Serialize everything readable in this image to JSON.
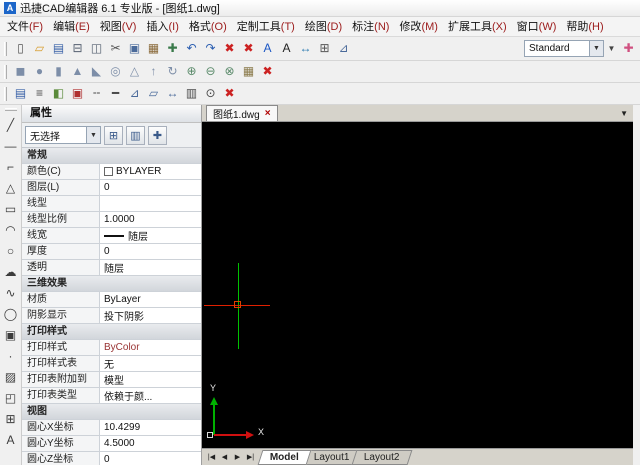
{
  "colors": {
    "canvas_bg": "#000000",
    "crosshair_x": "#e02000",
    "crosshair_y": "#00c000",
    "close_red": "#cc2222",
    "logo_blue": "#1d66c9",
    "bycolor_value": "#993333",
    "end_icon_pink": "#d05080"
  },
  "window": {
    "logo": "A",
    "title": "迅捷CAD编辑器 6.1 专业版 - [图纸1.dwg]"
  },
  "menu": {
    "items": [
      {
        "label": "文件",
        "key": "F"
      },
      {
        "label": "编辑",
        "key": "E"
      },
      {
        "label": "视图",
        "key": "V"
      },
      {
        "label": "插入",
        "key": "I"
      },
      {
        "label": "格式",
        "key": "O"
      },
      {
        "label": "定制工具",
        "key": "T"
      },
      {
        "label": "绘图",
        "key": "D"
      },
      {
        "label": "标注",
        "key": "N"
      },
      {
        "label": "修改",
        "key": "M"
      },
      {
        "label": "扩展工具",
        "key": "X"
      },
      {
        "label": "窗口",
        "key": "W"
      },
      {
        "label": "帮助",
        "key": "H"
      }
    ]
  },
  "toolbar1": {
    "icons": [
      {
        "name": "new-file-icon",
        "glyph": "▯",
        "color": "#555555"
      },
      {
        "name": "open-folder-icon",
        "glyph": "▱",
        "color": "#d79b2a"
      },
      {
        "name": "save-icon",
        "glyph": "▤",
        "color": "#3a62a8"
      },
      {
        "name": "print-icon",
        "glyph": "⊟",
        "color": "#556070"
      },
      {
        "name": "print-preview-icon",
        "glyph": "◫",
        "color": "#556070"
      },
      {
        "name": "cut-icon",
        "glyph": "✂",
        "color": "#555555"
      },
      {
        "name": "copy-icon",
        "glyph": "▣",
        "color": "#4a6a9a"
      },
      {
        "name": "paste-icon",
        "glyph": "▦",
        "color": "#8a6a3a"
      },
      {
        "name": "match-properties-icon",
        "glyph": "✚",
        "color": "#3a7a4a"
      },
      {
        "name": "undo-icon",
        "glyph": "↶",
        "color": "#2a5db0"
      },
      {
        "name": "redo-icon",
        "glyph": "↷",
        "color": "#2a5db0"
      },
      {
        "name": "erase-icon",
        "glyph": "✖",
        "color": "#cc2222"
      },
      {
        "name": "delete-icon",
        "glyph": "✖",
        "color": "#cc2222"
      },
      {
        "name": "text-style-icon",
        "glyph": "A",
        "color": "#1a56c4"
      },
      {
        "name": "text-icon",
        "glyph": "A",
        "color": "#222222"
      },
      {
        "name": "dimension-icon",
        "glyph": "↔",
        "color": "#2a7ab0"
      },
      {
        "name": "insert-table-icon",
        "glyph": "⊞",
        "color": "#555555"
      },
      {
        "name": "measure-icon",
        "glyph": "⊿",
        "color": "#4a6a9a"
      }
    ],
    "style_combo": {
      "value": "Standard",
      "arrow": "▼"
    },
    "extra_arrow": "▼",
    "end_icon": {
      "name": "add-style-icon",
      "glyph": "✚"
    }
  },
  "toolbar2": {
    "icons": [
      {
        "name": "box-icon",
        "glyph": "◼",
        "color": "#7d8ea8"
      },
      {
        "name": "sphere-icon",
        "glyph": "●",
        "color": "#7d8ea8"
      },
      {
        "name": "cylinder-icon",
        "glyph": "▮",
        "color": "#7d8ea8"
      },
      {
        "name": "cone-icon",
        "glyph": "▲",
        "color": "#7d8ea8"
      },
      {
        "name": "wedge-icon",
        "glyph": "◣",
        "color": "#7d8ea8"
      },
      {
        "name": "torus-icon",
        "glyph": "◎",
        "color": "#7d8ea8"
      },
      {
        "name": "pyramid-icon",
        "glyph": "△",
        "color": "#7d8ea8"
      },
      {
        "name": "extrude-icon",
        "glyph": "↑",
        "color": "#7d8ea8"
      },
      {
        "name": "revolve-icon",
        "glyph": "↻",
        "color": "#7d8ea8"
      },
      {
        "name": "union-icon",
        "glyph": "⊕",
        "color": "#5a8a6a"
      },
      {
        "name": "subtract-icon",
        "glyph": "⊖",
        "color": "#5a8a6a"
      },
      {
        "name": "intersect-icon",
        "glyph": "⊗",
        "color": "#5a8a6a"
      },
      {
        "name": "render-icon",
        "glyph": "▦",
        "color": "#8a7a4a"
      },
      {
        "name": "close-toolbar-icon",
        "glyph": "✖",
        "color": "#cc2222"
      }
    ]
  },
  "toolbar3": {
    "icons": [
      {
        "name": "properties-panel-icon",
        "glyph": "▤",
        "color": "#3a62a8"
      },
      {
        "name": "layers-icon",
        "glyph": "≡",
        "color": "#4a4a4a"
      },
      {
        "name": "layer-state-icon",
        "glyph": "◧",
        "color": "#5a8a3a"
      },
      {
        "name": "color-icon",
        "glyph": "▣",
        "color": "#b03030"
      },
      {
        "name": "linetype-icon",
        "glyph": "╌",
        "color": "#4a4a4a"
      },
      {
        "name": "lineweight-icon",
        "glyph": "━",
        "color": "#4a4a4a"
      },
      {
        "name": "measure-triangle-icon",
        "glyph": "⊿",
        "color": "#4a6a9a"
      },
      {
        "name": "area-icon",
        "glyph": "▱",
        "color": "#4a6a9a"
      },
      {
        "name": "distance-icon",
        "glyph": "↔",
        "color": "#4a6a9a"
      },
      {
        "name": "list-icon",
        "glyph": "▥",
        "color": "#4a4a4a"
      },
      {
        "name": "id-point-icon",
        "glyph": "⊙",
        "color": "#4a4a4a"
      },
      {
        "name": "close-toolbar-icon",
        "glyph": "✖",
        "color": "#cc2222"
      }
    ]
  },
  "draw_toolbar": {
    "icons": [
      {
        "name": "line-icon",
        "glyph": "╱"
      },
      {
        "name": "construction-line-icon",
        "glyph": "—"
      },
      {
        "name": "polyline-icon",
        "glyph": "⌐"
      },
      {
        "name": "polygon-icon",
        "glyph": "△"
      },
      {
        "name": "rectangle-icon",
        "glyph": "▭"
      },
      {
        "name": "arc-icon",
        "glyph": "◠"
      },
      {
        "name": "circle-icon",
        "glyph": "○"
      },
      {
        "name": "revision-cloud-icon",
        "glyph": "☁"
      },
      {
        "name": "spline-icon",
        "glyph": "∿"
      },
      {
        "name": "ellipse-icon",
        "glyph": "◯"
      },
      {
        "name": "insert-block-icon",
        "glyph": "▣"
      },
      {
        "name": "point-icon",
        "glyph": "·"
      },
      {
        "name": "hatch-icon",
        "glyph": "▨"
      },
      {
        "name": "region-icon",
        "glyph": "◰"
      },
      {
        "name": "table-icon",
        "glyph": "⊞"
      },
      {
        "name": "text-icon",
        "glyph": "A"
      }
    ]
  },
  "doc_tabs": {
    "active": "图纸1.dwg",
    "close": "×",
    "menu_arrow": "▼"
  },
  "properties": {
    "title": "属性",
    "selector": {
      "value": "无选择",
      "arrow": "▼"
    },
    "tool_icons": [
      {
        "name": "toggle-value-icon",
        "glyph": "⊞"
      },
      {
        "name": "properties-settings-icon",
        "glyph": "▥"
      },
      {
        "name": "quick-select-icon",
        "glyph": "✚"
      }
    ],
    "rows": [
      {
        "type": "header",
        "label": "常规"
      },
      {
        "type": "row",
        "label": "颜色(C)",
        "value": "BYLAYER",
        "swatch": true
      },
      {
        "type": "row",
        "label": "图层(L)",
        "value": "0"
      },
      {
        "type": "row",
        "label": "线型",
        "value": ""
      },
      {
        "type": "row",
        "label": "线型比例",
        "value": "1.0000"
      },
      {
        "type": "row",
        "label": "线宽",
        "value": "随层",
        "line": true
      },
      {
        "type": "row",
        "label": "厚度",
        "value": "0"
      },
      {
        "type": "row",
        "label": "透明",
        "value": "随层"
      },
      {
        "type": "header",
        "label": "三维效果"
      },
      {
        "type": "row",
        "label": "材质",
        "value": "ByLayer"
      },
      {
        "type": "row",
        "label": "阴影显示",
        "value": "投下阴影"
      },
      {
        "type": "header",
        "label": "打印样式"
      },
      {
        "type": "row",
        "label": "打印样式",
        "value": "ByColor",
        "color": "#993333"
      },
      {
        "type": "row",
        "label": "打印样式表",
        "value": "无"
      },
      {
        "type": "row",
        "label": "打印表附加到",
        "value": "模型"
      },
      {
        "type": "row",
        "label": "打印表类型",
        "value": "依赖于颜..."
      },
      {
        "type": "header",
        "label": "视图"
      },
      {
        "type": "row",
        "label": "圆心X坐标",
        "value": "10.4299"
      },
      {
        "type": "row",
        "label": "圆心Y坐标",
        "value": "4.5000"
      },
      {
        "type": "row",
        "label": "圆心Z坐标",
        "value": "0"
      }
    ]
  },
  "canvas": {
    "x_label": "X",
    "y_label": "Y"
  },
  "layout_tabs": {
    "nav": [
      {
        "name": "first-tab-button",
        "glyph": "|◀"
      },
      {
        "name": "prev-tab-button",
        "glyph": "◀"
      },
      {
        "name": "next-tab-button",
        "glyph": "▶"
      },
      {
        "name": "last-tab-button",
        "glyph": "▶|"
      }
    ],
    "tabs": [
      {
        "label": "Model",
        "state": "active"
      },
      {
        "label": "Layout1",
        "state": ""
      },
      {
        "label": "Layout2",
        "state": ""
      }
    ]
  }
}
